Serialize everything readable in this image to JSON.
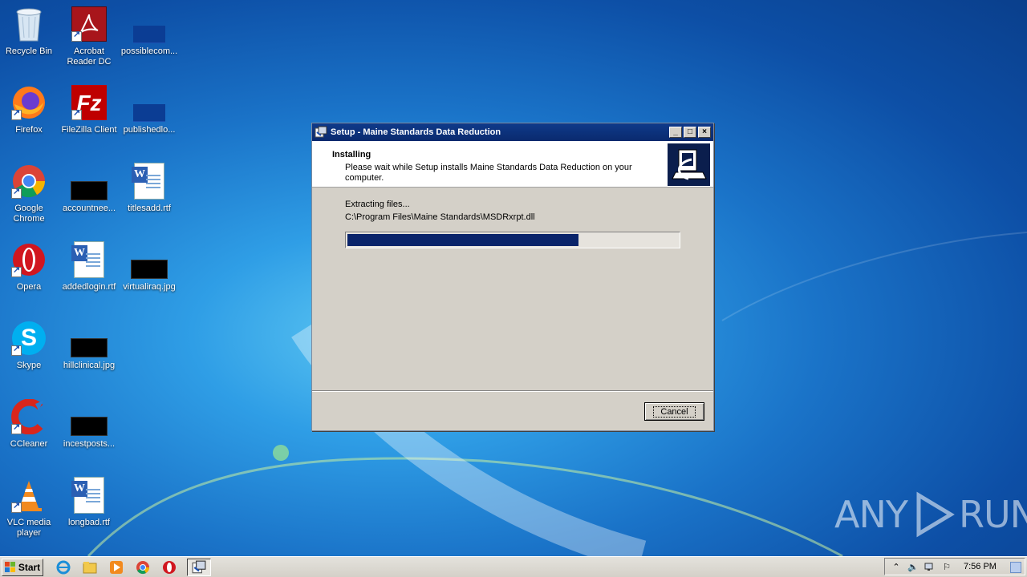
{
  "desktop": {
    "icons": [
      {
        "label": "Recycle Bin",
        "icon": "recycle-bin-icon"
      },
      {
        "label": "Acrobat Reader DC",
        "icon": "acrobat-icon"
      },
      {
        "label": "possiblecom...",
        "icon": "file-thumbnail-icon"
      },
      {
        "label": "Firefox",
        "icon": "firefox-icon"
      },
      {
        "label": "FileZilla Client",
        "icon": "filezilla-icon"
      },
      {
        "label": "publishedlo...",
        "icon": "file-thumbnail-icon"
      },
      {
        "label": "Google Chrome",
        "icon": "chrome-icon"
      },
      {
        "label": "accountnee...",
        "icon": "file-thumbnail-icon"
      },
      {
        "label": "titlesadd.rtf",
        "icon": "word-document-icon"
      },
      {
        "label": "Opera",
        "icon": "opera-icon"
      },
      {
        "label": "addedlogin.rtf",
        "icon": "word-document-icon"
      },
      {
        "label": "virtualiraq.jpg",
        "icon": "image-thumbnail-icon"
      },
      {
        "label": "Skype",
        "icon": "skype-icon"
      },
      {
        "label": "hillclinical.jpg",
        "icon": "image-thumbnail-icon"
      },
      {
        "label": "CCleaner",
        "icon": "ccleaner-icon"
      },
      {
        "label": "incestposts...",
        "icon": "file-thumbnail-icon"
      },
      {
        "label": "VLC media player",
        "icon": "vlc-icon"
      },
      {
        "label": "longbad.rtf",
        "icon": "word-document-icon"
      }
    ]
  },
  "dialog": {
    "title": "Setup - Maine Standards Data Reduction",
    "header_title": "Installing",
    "header_desc": "Please wait while Setup installs Maine Standards Data Reduction on your computer.",
    "status": "Extracting files...",
    "filename": "C:\\Program Files\\Maine Standards\\MSDRxrpt.dll",
    "progress_fraction": 0.7,
    "cancel_label": "Cancel",
    "minimize_glyph": "_",
    "maximize_glyph": "□",
    "close_glyph": "×"
  },
  "watermark": {
    "left": "ANY",
    "right": "RUN"
  },
  "taskbar": {
    "start_label": "Start",
    "clock": "7:56 PM",
    "quick_launch": [
      "ie-icon",
      "explorer-folder-icon",
      "media-player-icon",
      "chrome-icon",
      "opera-icon"
    ],
    "active_task": "setup-task-icon",
    "tray_icons": [
      "show-hidden-icons-arrow",
      "volume-icon",
      "network-icon",
      "action-center-flag-icon"
    ]
  },
  "colors": {
    "titlebar": "#0a2a6e",
    "progress_fill": "#0a246a",
    "dialog_face": "#d4d0c8"
  }
}
